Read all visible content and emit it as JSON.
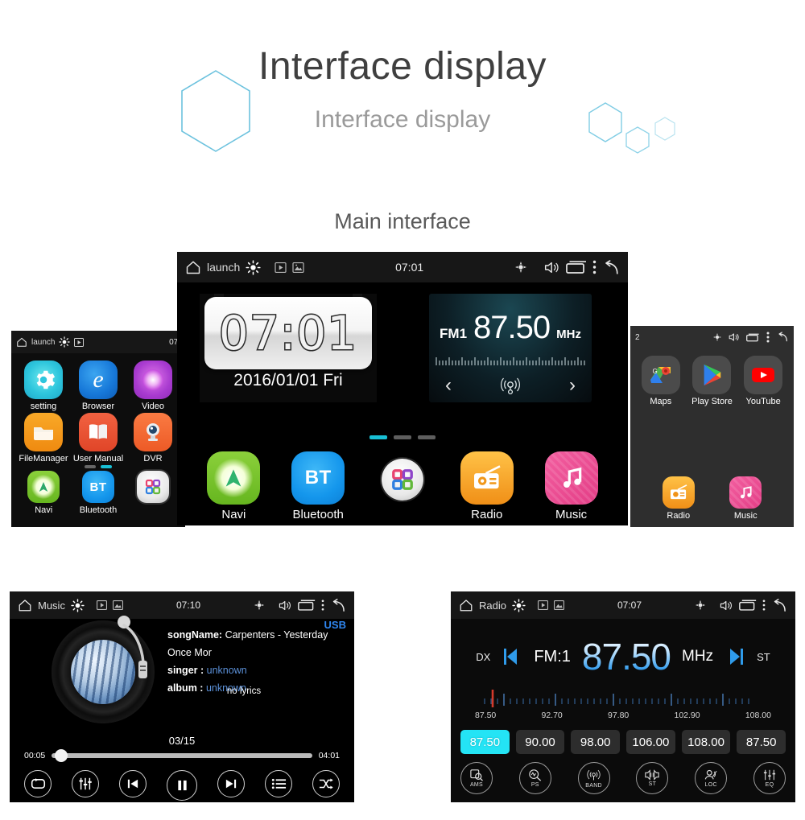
{
  "header": {
    "title": "Interface display",
    "subtitle": "Interface display",
    "accent_color": "#5bb8d8"
  },
  "section": {
    "main_interface_title": "Main interface"
  },
  "main_screen": {
    "statusbar": {
      "home_icon": "home-icon",
      "app_label": "launch",
      "brightness_icon": "brightness-icon",
      "play_icon": "play-icon",
      "gallery_icon": "gallery-icon",
      "time": "07:01",
      "gps_icon": "gps-icon",
      "volume_icon": "volume-icon",
      "recents_icon": "recents-icon",
      "overflow_icon": "overflow-menu-icon",
      "back_icon": "back-icon"
    },
    "clock_widget": {
      "time": "07:01",
      "date": "2016/01/01 Fri"
    },
    "radio_widget": {
      "band": "FM1",
      "frequency": "87.50",
      "unit": "MHz",
      "prev_icon": "chevron-left-icon",
      "next_icon": "chevron-right-icon",
      "signal_icon": "radio-signal-icon"
    },
    "page_dots": {
      "count": 3,
      "active": 0
    },
    "dock": [
      {
        "label": "Navi",
        "icon": "navi-icon"
      },
      {
        "label": "Bluetooth",
        "icon": "bluetooth-icon",
        "glyph": "BT"
      },
      {
        "label": "",
        "icon": "app-drawer-icon"
      },
      {
        "label": "Radio",
        "icon": "radio-icon"
      },
      {
        "label": "Music",
        "icon": "music-icon"
      }
    ]
  },
  "left_screen": {
    "statusbar": {
      "app_label": "launch",
      "time": "07:"
    },
    "apps": [
      {
        "label": "setting",
        "icon": "settings-gear-icon"
      },
      {
        "label": "Browser",
        "icon": "browser-icon"
      },
      {
        "label": "Video",
        "icon": "video-icon"
      },
      {
        "label": "FileManager",
        "icon": "file-manager-icon"
      },
      {
        "label": "User Manual",
        "icon": "user-manual-icon"
      },
      {
        "label": "DVR",
        "icon": "dvr-camera-icon"
      }
    ],
    "dock": [
      {
        "label": "Navi",
        "icon": "navi-icon"
      },
      {
        "label": "Bluetooth",
        "icon": "bluetooth-icon",
        "glyph": "BT"
      },
      {
        "label": "",
        "icon": "app-drawer-icon"
      }
    ]
  },
  "right_screen": {
    "statusbar": {
      "time": "2"
    },
    "apps": [
      {
        "label": "Maps",
        "icon": "google-maps-icon"
      },
      {
        "label": "Play Store",
        "icon": "play-store-icon"
      },
      {
        "label": "YouTube",
        "icon": "youtube-icon"
      }
    ],
    "dock": [
      {
        "label": "Radio",
        "icon": "radio-icon"
      },
      {
        "label": "Music",
        "icon": "music-icon"
      }
    ]
  },
  "music_screen": {
    "statusbar": {
      "app_label": "Music",
      "time": "07:10"
    },
    "source_badge": "USB",
    "metadata": [
      {
        "key": "songName:",
        "value": "Carpenters - Yesterday Once Mor"
      },
      {
        "key": "singer :",
        "value": "unknown"
      },
      {
        "key": "album :",
        "value": "unknown"
      }
    ],
    "lyrics": "no lyrics",
    "track_index": "03/15",
    "elapsed": "00:05",
    "duration": "04:01",
    "progress_percent": 2,
    "controls": [
      {
        "name": "repeat-button",
        "icon": "repeat-icon"
      },
      {
        "name": "equalizer-button",
        "icon": "equalizer-icon"
      },
      {
        "name": "previous-button",
        "icon": "previous-track-icon"
      },
      {
        "name": "play-pause-button",
        "icon": "pause-icon"
      },
      {
        "name": "next-button",
        "icon": "next-track-icon"
      },
      {
        "name": "playlist-button",
        "icon": "playlist-icon"
      },
      {
        "name": "shuffle-button",
        "icon": "shuffle-icon"
      }
    ]
  },
  "radio_screen": {
    "statusbar": {
      "app_label": "Radio",
      "time": "07:07"
    },
    "dx_label": "DX",
    "st_label": "ST",
    "band": "FM:1",
    "frequency": "87.50",
    "unit": "MHz",
    "prev_icon": "previous-station-icon",
    "next_icon": "next-station-icon",
    "scale_labels": [
      "87.50",
      "92.70",
      "97.80",
      "102.90",
      "108.00"
    ],
    "tuner_marker_percent": 4,
    "presets": [
      {
        "value": "87.50",
        "active": true
      },
      {
        "value": "90.00",
        "active": false
      },
      {
        "value": "98.00",
        "active": false
      },
      {
        "value": "106.00",
        "active": false
      },
      {
        "value": "108.00",
        "active": false
      },
      {
        "value": "87.50",
        "active": false
      }
    ],
    "buttons": [
      {
        "label": "AMS",
        "icon": "ams-icon"
      },
      {
        "label": "PS",
        "icon": "ps-icon"
      },
      {
        "label": "BAND",
        "icon": "band-icon"
      },
      {
        "label": "ST",
        "icon": "stereo-icon"
      },
      {
        "label": "LOC",
        "icon": "loc-icon"
      },
      {
        "label": "EQ",
        "icon": "eq-icon"
      }
    ]
  }
}
